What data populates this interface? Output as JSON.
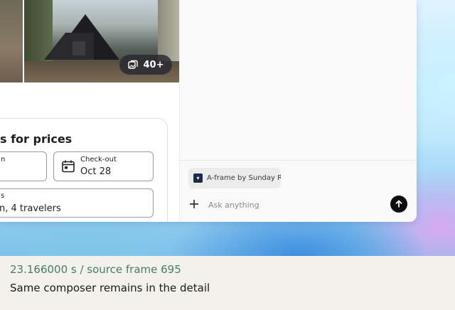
{
  "listing": {
    "photo_count_badge": "40+",
    "booking_title": "s for prices",
    "checkin_label": "n",
    "checkout_label": "Check-out",
    "checkout_value": "Oct 28",
    "guests_label": "s",
    "guests_value": "n, 4 travelers"
  },
  "assistant": {
    "context_chip_label": "A-frame by Sunday Ri",
    "input_placeholder": "Ask anything"
  },
  "caption": {
    "timestamp": "23.166000 s / source frame 695",
    "description": "Same composer remains in the detail"
  },
  "colors": {
    "send_button": "#0d0d0d",
    "chip_background": "#ececec",
    "caption_time": "#4a7a6a"
  }
}
